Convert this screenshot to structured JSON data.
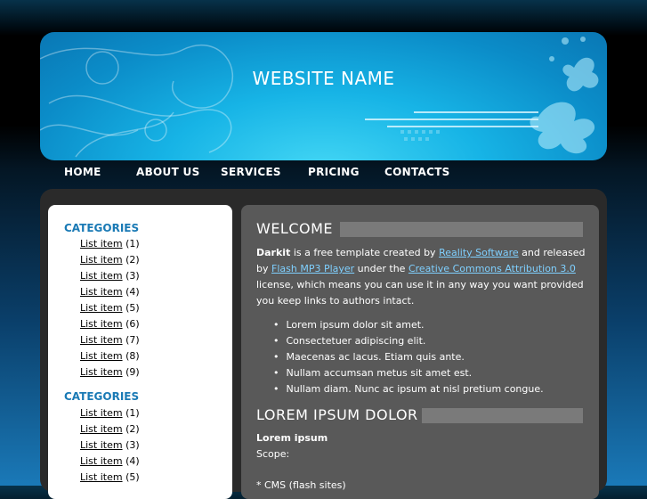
{
  "header": {
    "site_name": "WEBSITE NAME"
  },
  "nav": [
    "HOME",
    "ABOUT US",
    "SERVICES",
    "PRICING",
    "CONTACTS"
  ],
  "sidebar": {
    "sections": [
      {
        "title": "CATEGORIES",
        "items": [
          {
            "label": "List item",
            "count": "(1)"
          },
          {
            "label": "List item",
            "count": "(2)"
          },
          {
            "label": "List item",
            "count": "(3)"
          },
          {
            "label": "List item",
            "count": "(4)"
          },
          {
            "label": "List item",
            "count": "(5)"
          },
          {
            "label": "List item",
            "count": "(6)"
          },
          {
            "label": "List item",
            "count": "(7)"
          },
          {
            "label": "List item",
            "count": "(8)"
          },
          {
            "label": "List item",
            "count": "(9)"
          }
        ]
      },
      {
        "title": "CATEGORIES",
        "items": [
          {
            "label": "List item",
            "count": "(1)"
          },
          {
            "label": "List item",
            "count": "(2)"
          },
          {
            "label": "List item",
            "count": "(3)"
          },
          {
            "label": "List item",
            "count": "(4)"
          },
          {
            "label": "List item",
            "count": "(5)"
          }
        ]
      }
    ]
  },
  "content": {
    "welcome_title": "WELCOME",
    "intro": {
      "brand": "Darkit",
      "t1": " is a free template created by ",
      "link1": "Reality Software",
      "t2": " and released by ",
      "link2": "Flash MP3 Player",
      "t3": " under the ",
      "link3": "Creative Commons Attribution 3.0",
      "t4": " license, which means you can use it in any way you want provided you keep links to authors intact."
    },
    "bullets": [
      "Lorem ipsum dolor sit amet.",
      "Consectetuer adipiscing elit.",
      "Maecenas ac lacus. Etiam quis ante.",
      "Nullam accumsan metus sit amet est.",
      "Nullam diam. Nunc ac ipsum at nisl pretium congue."
    ],
    "section2_title": "LOREM IPSUM DOLOR",
    "lorem_heading": "Lorem ipsum",
    "scope_label": "Scope:",
    "cms_line": "* CMS (flash sites)"
  }
}
